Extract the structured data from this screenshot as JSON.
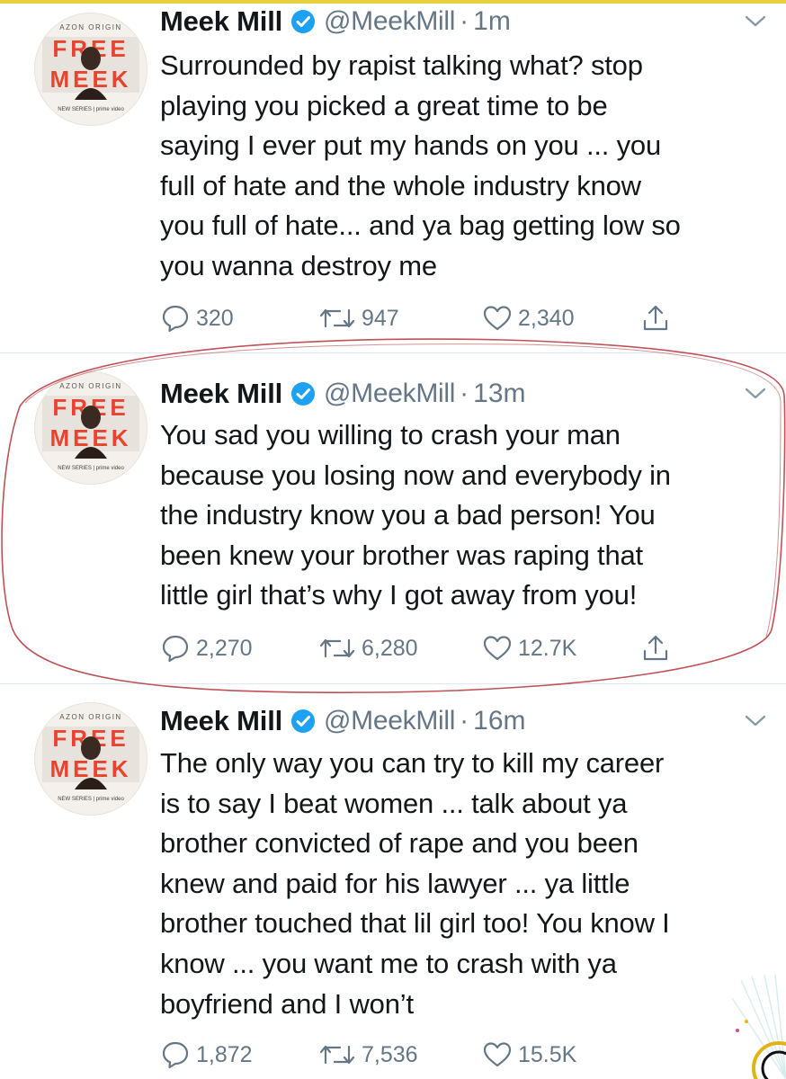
{
  "tweets": [
    {
      "name": "Meek Mill",
      "handle": "@MeekMill",
      "separator": "·",
      "time": "1m",
      "text": "Surrounded by rapist talking what? stop\nplaying you picked a great time to be\nsaying I ever put my hands on you ... you\nfull of hate and the whole industry know\nyou full of hate... and ya bag getting low so\nyou wanna destroy me",
      "replies": "320",
      "retweets": "947",
      "likes": "2,340"
    },
    {
      "name": "Meek Mill",
      "handle": "@MeekMill",
      "separator": "·",
      "time": "13m",
      "text": "You sad you willing to crash your man\nbecause you losing now and everybody in\nthe industry know you a bad person! You\nbeen knew your brother was raping that\nlittle girl that’s why I got away from you!",
      "replies": "2,270",
      "retweets": "6,280",
      "likes": "12.7K"
    },
    {
      "name": "Meek Mill",
      "handle": "@MeekMill",
      "separator": "·",
      "time": "16m",
      "text": "The only way you can try to kill my career\nis to say I beat women ... talk about ya\nbrother convicted of rape and you been\nknew and paid for his lawyer ... ya little\nbrother touched that lil girl too! You know I\nknow ... you want me to crash with ya\nboyfriend and I won’t",
      "replies": "1,872",
      "retweets": "7,536",
      "likes": "15.5K"
    }
  ],
  "avatar": {
    "top_text": "AZON ORIGIN",
    "line1": "FREE",
    "line2": "MEEK",
    "caption": "NEW SERIES | prime video"
  },
  "icons": {
    "verified": "verified-badge-icon",
    "caret": "chevron-down-icon",
    "reply": "reply-icon",
    "retweet": "retweet-icon",
    "like": "heart-icon",
    "share": "share-icon"
  },
  "colors": {
    "text": "#14171a",
    "muted": "#657786",
    "verified": "#1da1f2",
    "divider": "#e1e8ed",
    "avatar_red": "#e8432e",
    "scribble": "#b4343a"
  }
}
